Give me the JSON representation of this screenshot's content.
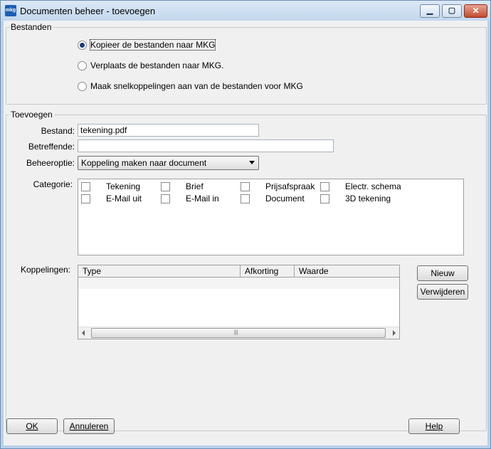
{
  "window": {
    "app_icon_text": "mkg",
    "title": "Documenten beheer - toevoegen",
    "min_glyph": "▁",
    "max_glyph": "▢",
    "close_glyph": "✕"
  },
  "bestanden": {
    "legend": "Bestanden",
    "options": [
      {
        "label": "Kopieer de bestanden naar MKG",
        "selected": true
      },
      {
        "label": "Verplaats de bestanden naar MKG.",
        "selected": false
      },
      {
        "label": "Maak snelkoppelingen aan van de bestanden voor MKG",
        "selected": false
      }
    ]
  },
  "toevoegen": {
    "legend": "Toevoegen",
    "bestand_label": "Bestand:",
    "bestand_value": "tekening.pdf",
    "betreffende_label": "Betreffende:",
    "betreffende_value": "",
    "beheeroptie_label": "Beheeroptie:",
    "beheeroptie_value": "Koppeling maken naar document",
    "categorie_label": "Categorie:",
    "categories": [
      "Tekening",
      "Brief",
      "Prijsafspraak",
      "Electr. schema",
      "E-Mail uit",
      "E-Mail in",
      "Document",
      "3D tekening"
    ],
    "koppelingen_label": "Koppelingen:",
    "grid_columns": [
      "Type",
      "Afkorting",
      "Waarde"
    ],
    "grip_glyph": "|||",
    "nieuw_label": "Nieuw",
    "verwijderen_label": "Verwijderen"
  },
  "footer": {
    "ok_label": "OK",
    "annuleren_label": "Annuleren",
    "help_label": "Help"
  }
}
